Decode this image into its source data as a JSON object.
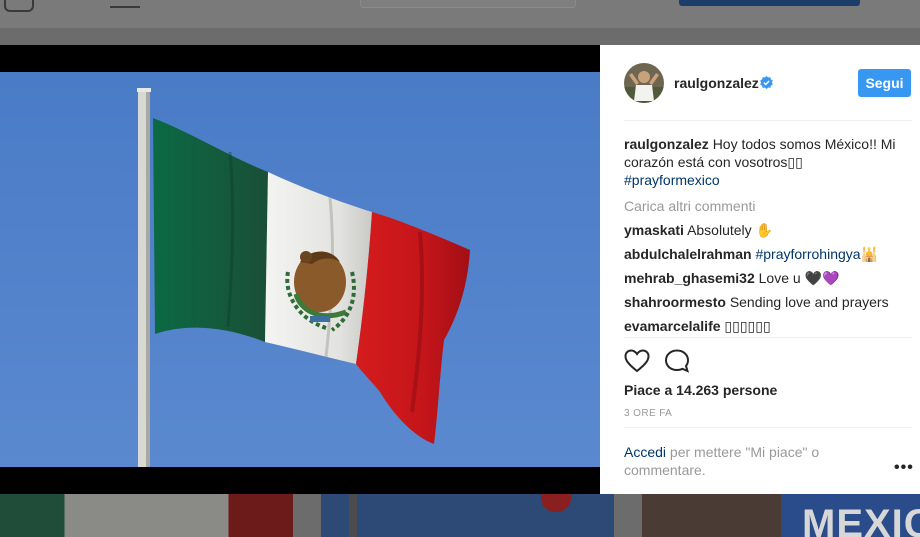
{
  "post": {
    "username": "raulgonzalez",
    "follow_label": "Segui",
    "caption_text": "Hoy todos somos México!! Mi corazón está con vosotros",
    "caption_emoji": "▯▯",
    "caption_hashtag": "#prayformexico",
    "load_more_label": "Carica altri commenti",
    "comments": [
      {
        "user": "ymaskati",
        "text": "Absolutely ✋",
        "tag": ""
      },
      {
        "user": "abdulchalelrahman",
        "text": "",
        "tag": "#prayforrohingya🕌"
      },
      {
        "user": "mehrab_ghasemi32",
        "text": "Love u 🖤💜",
        "tag": ""
      },
      {
        "user": "shahroormesto",
        "text": "Sending love and prayers",
        "tag": ""
      },
      {
        "user": "evamarcelalife",
        "text": "▯▯▯▯▯▯",
        "tag": ""
      }
    ],
    "likes_label": "Piace a 14.263 persone",
    "time_label": "3 ORE FA",
    "login_link": "Accedi",
    "login_text": "per mettere \"Mi piace\" o commentare.",
    "more_label": "•••"
  },
  "background": {
    "tile_word": "MEXICO"
  },
  "colors": {
    "follow_button": "#3897f0",
    "link": "#003569",
    "sky": "#4f7ec7",
    "flag_green": "#006847",
    "flag_red": "#ce1126"
  }
}
